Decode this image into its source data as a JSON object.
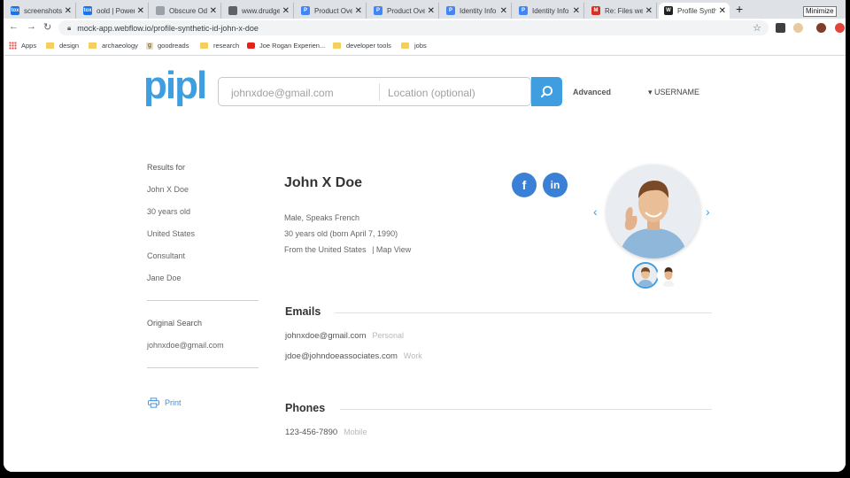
{
  "browser": {
    "tabs": [
      {
        "title": "screenshots",
        "favicon_color": "#1a73e8",
        "favicon_text": "tox"
      },
      {
        "title": "oold | Power",
        "favicon_color": "#1a73e8",
        "favicon_text": "tox"
      },
      {
        "title": "Obscure Odd",
        "favicon_color": "#9aa0a6",
        "favicon_text": ""
      },
      {
        "title": "www.drudge",
        "favicon_color": "#5f6368",
        "favicon_text": ""
      },
      {
        "title": "Product Ove",
        "favicon_color": "#4285f4",
        "favicon_text": "P"
      },
      {
        "title": "Product Ove",
        "favicon_color": "#4285f4",
        "favicon_text": "P"
      },
      {
        "title": "Identity Info",
        "favicon_color": "#4285f4",
        "favicon_text": "P"
      },
      {
        "title": "Identity Info",
        "favicon_color": "#4285f4",
        "favicon_text": "P"
      },
      {
        "title": "Re: Files we",
        "favicon_color": "#d93025",
        "favicon_text": "M"
      },
      {
        "title": "Profile Synth",
        "favicon_color": "#202124",
        "favicon_text": "W"
      }
    ],
    "active_tab_index": 9,
    "new_tab_label": "+",
    "minimize_tooltip": "Minimize",
    "url": "mock-app.webflow.io/profile-synthetic-id-john-x-doe",
    "bookmarks": [
      {
        "label": "Apps",
        "icon": "apps-grid-icon"
      },
      {
        "label": "design",
        "icon": "folder-icon"
      },
      {
        "label": "archaeology",
        "icon": "folder-icon"
      },
      {
        "label": "goodreads",
        "icon": "goodreads-icon"
      },
      {
        "label": "research",
        "icon": "folder-icon"
      },
      {
        "label": "Joe Rogan Experien...",
        "icon": "youtube-icon"
      },
      {
        "label": "developer tools",
        "icon": "folder-icon"
      },
      {
        "label": "jobs",
        "icon": "folder-icon"
      }
    ]
  },
  "site": {
    "logo": "pipl",
    "brand_color": "#3f9ee0",
    "search": {
      "email_placeholder": "johnxdoe@gmail.com",
      "location_placeholder": "Location (optional)"
    },
    "advanced_label": "Advanced",
    "username_label": "USERNAME"
  },
  "sidebar": {
    "results_for_label": "Results for",
    "results": [
      "John X Doe",
      "30 years old",
      "United States",
      "Consultant",
      "Jane Doe"
    ],
    "original_search_label": "Original Search",
    "original_search_value": "johnxdoe@gmail.com",
    "print_label": "Print"
  },
  "profile": {
    "name": "John X Doe",
    "line1": "Male, Speaks French",
    "line2": "30 years old (born April 7, 1990)",
    "line3_prefix": "From the United States",
    "map_view": "| Map View",
    "social": [
      {
        "label": "f",
        "icon": "facebook-icon"
      },
      {
        "label": "in",
        "icon": "linkedin-icon"
      }
    ]
  },
  "emails": {
    "title": "Emails",
    "items": [
      {
        "value": "johnxdoe@gmail.com",
        "tag": "Personal"
      },
      {
        "value": "jdoe@johndoeassociates.com",
        "tag": "Work"
      }
    ]
  },
  "phones": {
    "title": "Phones",
    "items": [
      {
        "value": "123-456-7890",
        "tag": "Mobile"
      }
    ]
  }
}
